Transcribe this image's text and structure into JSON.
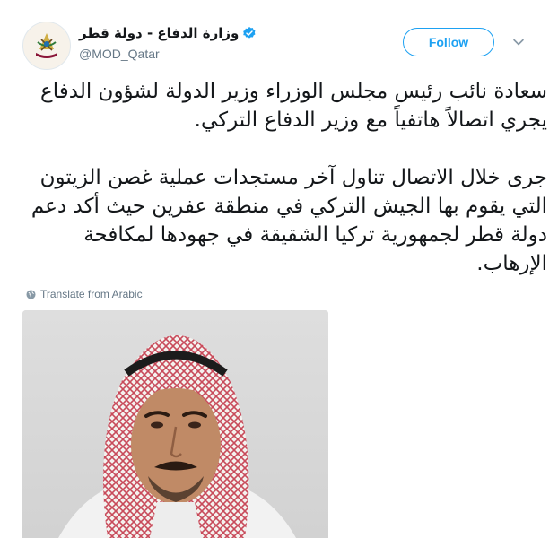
{
  "account": {
    "display_name": "وزارة الدفاع - دولة قطر",
    "handle": "@MOD_Qatar",
    "verified": true,
    "avatar_icon": "ministry-emblem-icon"
  },
  "actions": {
    "follow_label": "Follow",
    "menu_icon": "chevron-down-icon"
  },
  "tweet": {
    "text": "سعادة نائب رئيس مجلس الوزراء وزير الدولة لشؤون الدفاع يجري اتصالاً هاتفياً مع وزير الدفاع التركي.\n\nجرى خلال الاتصال تناول آخر مستجدات عملية غصن الزيتون التي يقوم بها الجيش التركي في منطقة عفرين حيث أكد دعم دولة قطر لجمهورية تركيا الشقيقة في جهودها لمكافحة الإرهاب.",
    "translate_label": "Translate from Arabic"
  },
  "colors": {
    "accent": "#1da1f2",
    "secondary_text": "#657786",
    "primary_text": "#14171a"
  }
}
